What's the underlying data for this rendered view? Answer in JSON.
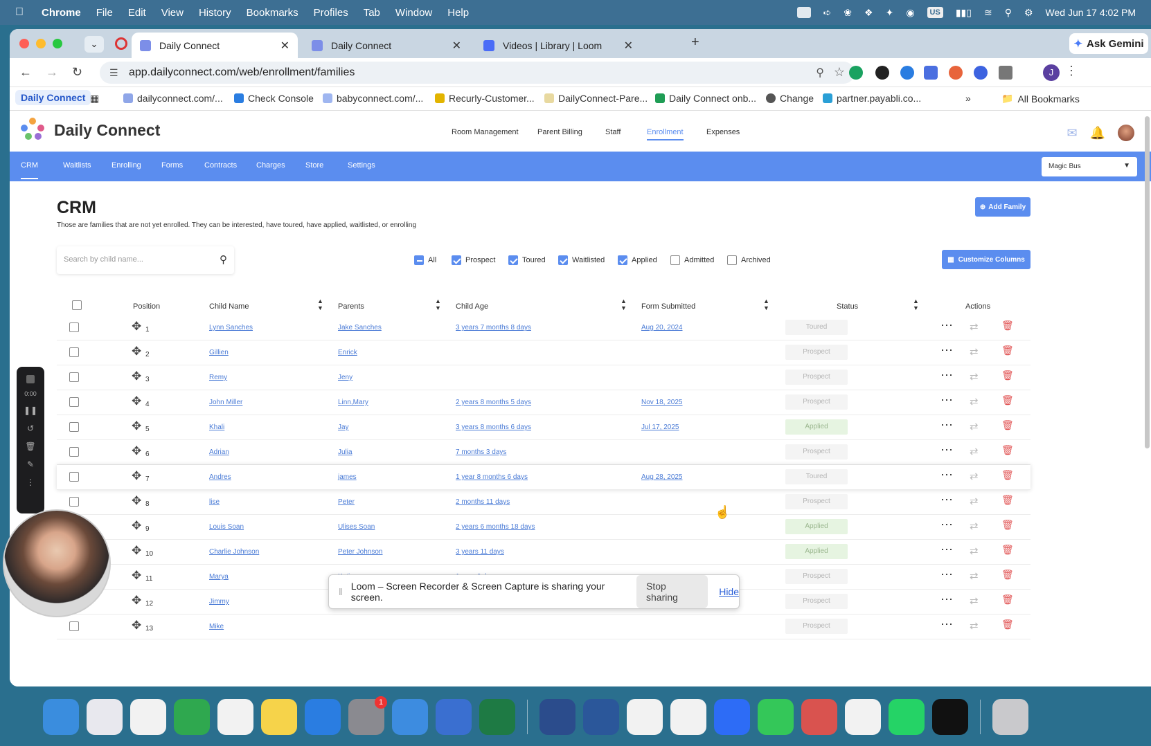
{
  "menubar": {
    "app": "Chrome",
    "items": [
      "File",
      "Edit",
      "View",
      "History",
      "Bookmarks",
      "Profiles",
      "Tab",
      "Window",
      "Help"
    ],
    "input_badge": "US",
    "datetime": "Wed Jun 17  4:02 PM"
  },
  "browser": {
    "tabs": [
      {
        "title": "Daily Connect"
      },
      {
        "title": "Daily Connect"
      },
      {
        "title": "Videos | Library | Loom"
      }
    ],
    "gemini": "Ask Gemini",
    "url": "app.dailyconnect.com/web/enrollment/families",
    "profile_initial": "J",
    "bookmarks": [
      "Daily Connect",
      "dailyconnect.com/...",
      "Check Console",
      "babyconnect.com/...",
      "Recurly-Customer...",
      "DailyConnect-Pare...",
      "Daily Connect onb...",
      "Change",
      "partner.payabli.co..."
    ],
    "all_bookmarks": "All Bookmarks"
  },
  "app": {
    "brand": "Daily Connect",
    "topnav": [
      "Room Management",
      "Parent Billing",
      "Staff",
      "Enrollment",
      "Expenses"
    ],
    "subnav": [
      "CRM",
      "Waitlists",
      "Enrolling",
      "Forms",
      "Contracts",
      "Charges",
      "Store",
      "Settings"
    ],
    "location": "Magic Bus"
  },
  "crm": {
    "title": "CRM",
    "description": "Those are families that are not yet enrolled. They can be interested, have toured, have applied, waitlisted, or enrolling",
    "add_family": "Add Family",
    "search_placeholder": "Search by child name...",
    "filters": [
      {
        "label": "All",
        "state": "partial"
      },
      {
        "label": "Prospect",
        "state": "checked"
      },
      {
        "label": "Toured",
        "state": "checked"
      },
      {
        "label": "Waitlisted",
        "state": "checked"
      },
      {
        "label": "Applied",
        "state": "checked"
      },
      {
        "label": "Admitted",
        "state": "unchecked"
      },
      {
        "label": "Archived",
        "state": "unchecked"
      }
    ],
    "customize_columns": "Customize Columns",
    "columns": [
      "Position",
      "Child Name",
      "Parents",
      "Child Age",
      "Form Submitted",
      "Status",
      "Actions"
    ],
    "rows": [
      {
        "pos": "1",
        "child": "Lynn Sanches",
        "parents": "Jake Sanches",
        "age": "3 years 7 months 8 days",
        "form": "Aug 20, 2024",
        "status": "Toured"
      },
      {
        "pos": "2",
        "child": "Gillien",
        "parents": "Enrick",
        "age": "",
        "form": "",
        "status": "Prospect"
      },
      {
        "pos": "3",
        "child": "Remy",
        "parents": "Jeny",
        "age": "",
        "form": "",
        "status": "Prospect"
      },
      {
        "pos": "4",
        "child": "John Miller",
        "parents": "Linn,Mary",
        "age": "2 years 8 months 5 days",
        "form": "Nov 18, 2025",
        "status": "Prospect"
      },
      {
        "pos": "5",
        "child": "Khali",
        "parents": "Jay",
        "age": "3 years 8 months 6 days",
        "form": "Jul 17, 2025",
        "status": "Applied"
      },
      {
        "pos": "6",
        "child": "Adrian",
        "parents": "Julia",
        "age": "7 months 3 days",
        "form": "",
        "status": "Prospect"
      },
      {
        "pos": "7",
        "child": "Andres",
        "parents": "james",
        "age": "1 year 8 months 6 days",
        "form": "Aug 28, 2025",
        "status": "Toured"
      },
      {
        "pos": "8",
        "child": "lise",
        "parents": "Peter",
        "age": "2 months 11 days",
        "form": "",
        "status": "Prospect"
      },
      {
        "pos": "9",
        "child": "Louis Soan",
        "parents": "Ulises Soan",
        "age": "2 years 6 months 18 days",
        "form": "",
        "status": "Applied"
      },
      {
        "pos": "10",
        "child": "Charlie Johnson",
        "parents": "Peter Johnson",
        "age": "3 years 11 days",
        "form": "",
        "status": "Applied"
      },
      {
        "pos": "11",
        "child": "Marya",
        "parents": "Katia",
        "age": "1 year 6 days",
        "form": "",
        "status": "Prospect"
      },
      {
        "pos": "12",
        "child": "Jimmy",
        "parents": "",
        "age": "",
        "form": "",
        "status": "Prospect"
      },
      {
        "pos": "13",
        "child": "Mike",
        "parents": "",
        "age": "",
        "form": "",
        "status": "Prospect"
      }
    ]
  },
  "recorder": {
    "time": "0:00"
  },
  "loom": {
    "message": "Loom – Screen Recorder & Screen Capture is sharing your screen.",
    "stop": "Stop sharing",
    "hide": "Hide"
  },
  "dock": {
    "apps": [
      "finder-icon",
      "launchpad-icon",
      "photos-icon",
      "numbers-icon",
      "reminders-icon",
      "notes-icon",
      "app-store-icon",
      "system-settings-icon",
      "screen-sharing-icon",
      "preview-icon",
      "excel-icon",
      "mail-icon",
      "word-icon",
      "chrome-icon",
      "slack-icon",
      "zoom-icon",
      "messages-icon",
      "claude-icon",
      "asana-icon",
      "whatsapp-icon",
      "chatgpt-icon",
      "trash-icon"
    ],
    "badges": {
      "system-settings-icon": "1"
    }
  },
  "colors": {
    "accent": "#5b8def",
    "danger": "#e15454",
    "link": "#4a7bd6"
  }
}
